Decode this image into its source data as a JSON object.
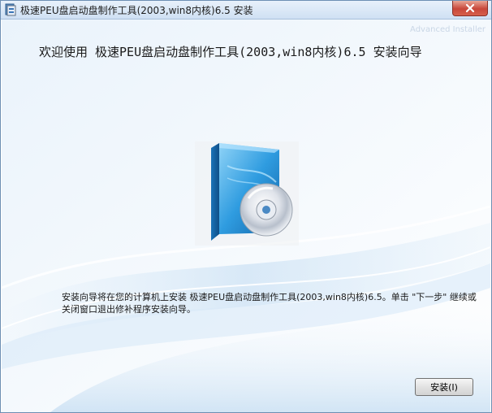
{
  "window": {
    "title": "极速PEU盘启动盘制作工具(2003,win8内核)6.5 安装",
    "close_label": "×"
  },
  "watermark": "Advanced Installer",
  "heading": "欢迎使用 极速PEU盘启动盘制作工具(2003,win8内核)6.5 安装向导",
  "description": "安装向导将在您的计算机上安装 极速PEU盘启动盘制作工具(2003,win8内核)6.5。单击 \"下一步\" 继续或关闭窗口退出修补程序安装向导。",
  "buttons": {
    "install_label": "安装(I)"
  },
  "icons": {
    "title": "installer-app-icon",
    "product": "software-box-disc-icon",
    "close": "close-icon"
  },
  "colors": {
    "accent": "#2a8fd6",
    "close_button": "#c8473a"
  }
}
